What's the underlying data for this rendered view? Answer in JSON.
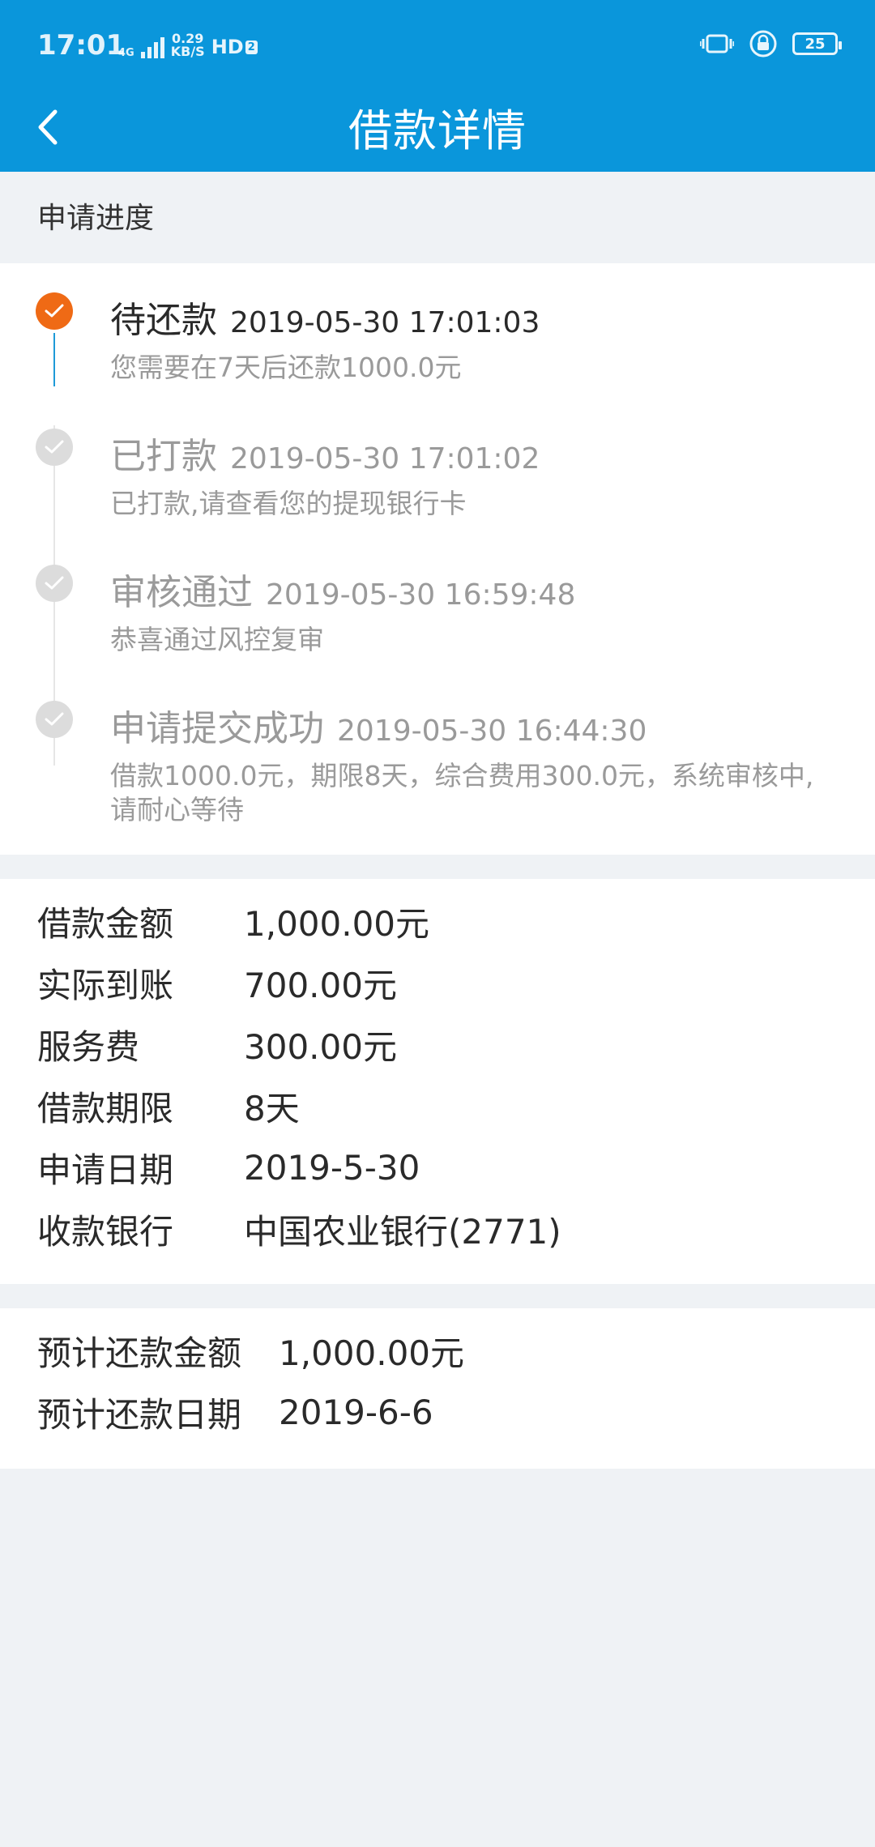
{
  "status_bar": {
    "time": "17:01",
    "network": "4G",
    "speed_value": "0.29",
    "speed_unit": "KB/S",
    "hd_label": "HD",
    "hd_badge": "2",
    "battery": "25"
  },
  "nav": {
    "back_icon": "chevron-left-icon",
    "title": "借款详情"
  },
  "progress": {
    "section_label": "申请进度",
    "steps": [
      {
        "title": "待还款",
        "time": "2019-05-30 17:01:03",
        "desc": "您需要在7天后还款1000.0元",
        "state": "active"
      },
      {
        "title": "已打款",
        "time": "2019-05-30 17:01:02",
        "desc": "已打款,请查看您的提现银行卡",
        "state": "done"
      },
      {
        "title": "审核通过",
        "time": "2019-05-30 16:59:48",
        "desc": "恭喜通过风控复审",
        "state": "done"
      },
      {
        "title": "申请提交成功",
        "time": "2019-05-30 16:44:30",
        "desc": "借款1000.0元，期限8天，综合费用300.0元，系统审核中,请耐心等待",
        "state": "done"
      }
    ]
  },
  "loan_info": [
    {
      "label": "借款金额",
      "value": "1,000.00元"
    },
    {
      "label": "实际到账",
      "value": "700.00元"
    },
    {
      "label": "服务费",
      "value": "300.00元"
    },
    {
      "label": "借款期限",
      "value": "8天"
    },
    {
      "label": "申请日期",
      "value": "2019-5-30"
    },
    {
      "label": "收款银行",
      "value": "中国农业银行(2771)"
    }
  ],
  "repay_info": [
    {
      "label": "预计还款金额",
      "value": "1,000.00元"
    },
    {
      "label": "预计还款日期",
      "value": "2019-6-6"
    }
  ],
  "colors": {
    "header": "#0a96db",
    "active_dot": "#ef6a15",
    "done_dot": "#dcdcdc",
    "active_line": "#1e9ad8",
    "page_bg": "#eff2f5"
  }
}
